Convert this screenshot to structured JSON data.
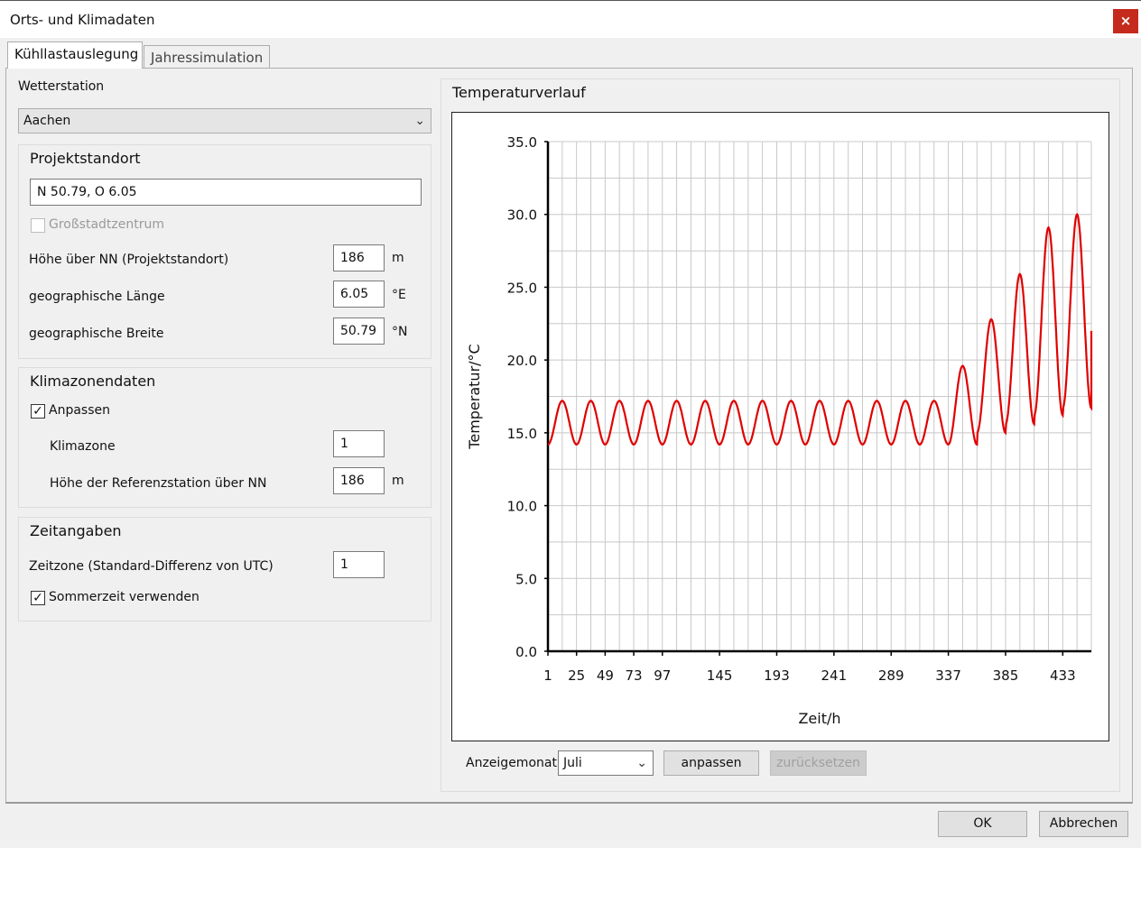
{
  "window": {
    "title": "Orts- und Klimadaten",
    "close_label": "×"
  },
  "tabs": [
    {
      "label": "Kühllastauslegung",
      "active": true
    },
    {
      "label": "Jahressimulation",
      "active": false
    }
  ],
  "wetterstation": {
    "label": "Wetterstation",
    "selected": "Aachen"
  },
  "projektstandort": {
    "title": "Projektstandort",
    "location_value": "N 50.79, O 6.05",
    "grossstadt_label": "Großstadtzentrum",
    "grossstadt_checked": false,
    "hoehe_label": "Höhe über NN (Projektstandort)",
    "hoehe_value": "186",
    "hoehe_unit": "m",
    "laenge_label": "geographische Länge",
    "laenge_value": "6.05",
    "laenge_unit": "°E",
    "breite_label": "geographische Breite",
    "breite_value": "50.79",
    "breite_unit": "°N"
  },
  "klimazonendaten": {
    "title": "Klimazonendaten",
    "anpassen_label": "Anpassen",
    "anpassen_checked": true,
    "klimazone_label": "Klimazone",
    "klimazone_value": "1",
    "ref_hoehe_label": "Höhe der Referenzstation über NN",
    "ref_hoehe_value": "186",
    "ref_hoehe_unit": "m"
  },
  "zeitangaben": {
    "title": "Zeitangaben",
    "zeitzone_label": "Zeitzone (Standard-Differenz von UTC)",
    "zeitzone_value": "1",
    "sommerzeit_label": "Sommerzeit verwenden",
    "sommerzeit_checked": true
  },
  "temperaturverlauf": {
    "title": "Temperaturverlauf",
    "anzeigemonat_label": "Anzeigemonat",
    "anzeigemonat_value": "Juli",
    "anpassen_button": "anpassen",
    "zuruecksetzen_button": "zurücksetzen"
  },
  "footer": {
    "ok_label": "OK",
    "cancel_label": "Abbrechen"
  },
  "colors": {
    "series": "#e00000",
    "grid": "#c8c8c8",
    "close": "#c42b1c"
  },
  "chart_data": {
    "type": "line",
    "xlabel": "Zeit/h",
    "ylabel": "Temperatur/°C",
    "xlim": [
      1,
      457
    ],
    "ylim": [
      0,
      35
    ],
    "y_ticks": [
      "0.0",
      "5.0",
      "10.0",
      "15.0",
      "20.0",
      "25.0",
      "30.0",
      "35.0"
    ],
    "x_ticks": [
      "1",
      "25",
      "49",
      "73",
      "97",
      "145",
      "193",
      "241",
      "289",
      "337",
      "385",
      "433"
    ],
    "grid": true,
    "series": [
      {
        "segments": [
          {
            "from": 1,
            "to": 337,
            "min": 14.2,
            "max": 17.2,
            "period": 24
          },
          {
            "from": 337,
            "to": 361,
            "min": 14.2,
            "max": 19.6,
            "period": 24
          },
          {
            "from": 361,
            "to": 385,
            "min": 15.0,
            "max": 22.8,
            "period": 24
          },
          {
            "from": 385,
            "to": 409,
            "min": 15.6,
            "max": 25.9,
            "period": 24
          },
          {
            "from": 409,
            "to": 433,
            "min": 16.2,
            "max": 29.1,
            "period": 24
          },
          {
            "from": 433,
            "to": 457,
            "min": 16.7,
            "max": 30.0,
            "period": 24
          }
        ],
        "end_value": 22.0
      }
    ]
  }
}
